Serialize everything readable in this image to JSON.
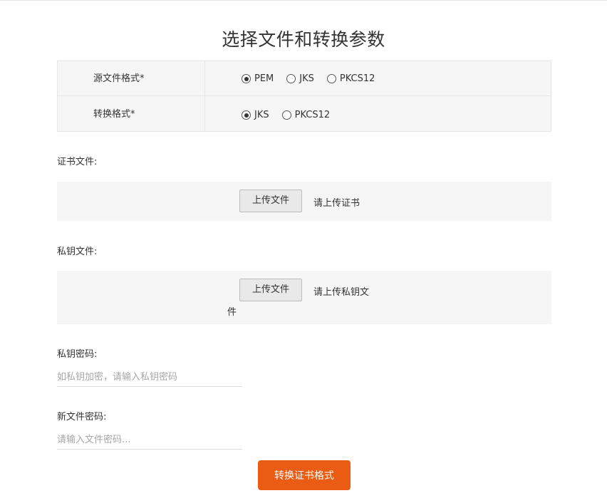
{
  "title": "选择文件和转换参数",
  "format_table": {
    "source": {
      "label": "源文件格式*",
      "options": [
        "PEM",
        "JKS",
        "PKCS12"
      ],
      "selected": "PEM"
    },
    "target": {
      "label": "转换格式*",
      "options": [
        "JKS",
        "PKCS12"
      ],
      "selected": "JKS"
    }
  },
  "cert_file": {
    "label": "证书文件:",
    "button": "上传文件",
    "hint": "请上传证书"
  },
  "key_file": {
    "label": "私钥文件:",
    "button": "上传文件",
    "hint_line1": "请上传私钥文",
    "hint_line2": "件"
  },
  "key_password": {
    "label": "私钥密码:",
    "placeholder": "如私钥加密，请输入私钥密码"
  },
  "new_password": {
    "label": "新文件密码:",
    "placeholder": "请输入文件密码..."
  },
  "submit": {
    "label": "转换证书格式"
  },
  "colors": {
    "accent": "#ea5b14",
    "panel_bg": "#f6f6f6",
    "border": "#e6e6e6"
  }
}
